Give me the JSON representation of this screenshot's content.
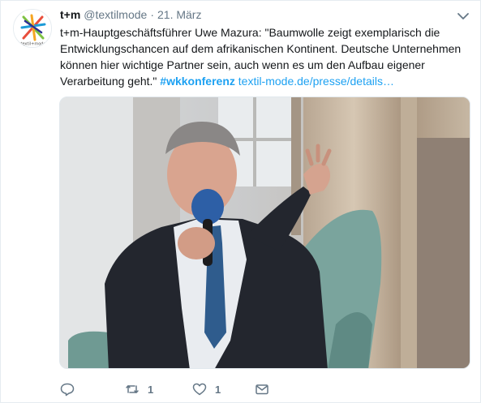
{
  "tweet": {
    "fullname": "t+m",
    "handle": "@textilmode",
    "separator": "·",
    "time": "21. März",
    "text_main": "t+m-Hauptgeschäftsführer Uwe Mazura: \"Baumwolle zeigt exemplarisch die Entwicklungschancen auf dem afrikanischen Kontinent. Deutsche Unternehmen können hier wichtige Partner sein, auch wenn es um den Aufbau eigener Verarbeitung geht.\" ",
    "hashtag": "#wkkonferenz",
    "link": "textil-mode.de/presse/details…",
    "avatar_text": "textil+mode"
  },
  "actions": {
    "reply_count": "",
    "retweet_count": "1",
    "like_count": "1",
    "dm_count": ""
  },
  "icons": {
    "caret": "chevron-down-icon",
    "reply": "reply-icon",
    "retweet": "retweet-icon",
    "like": "heart-icon",
    "dm": "envelope-icon"
  },
  "colors": {
    "accent": "#1da1f2",
    "secondary_text": "#657786",
    "primary_text": "#14171a"
  }
}
